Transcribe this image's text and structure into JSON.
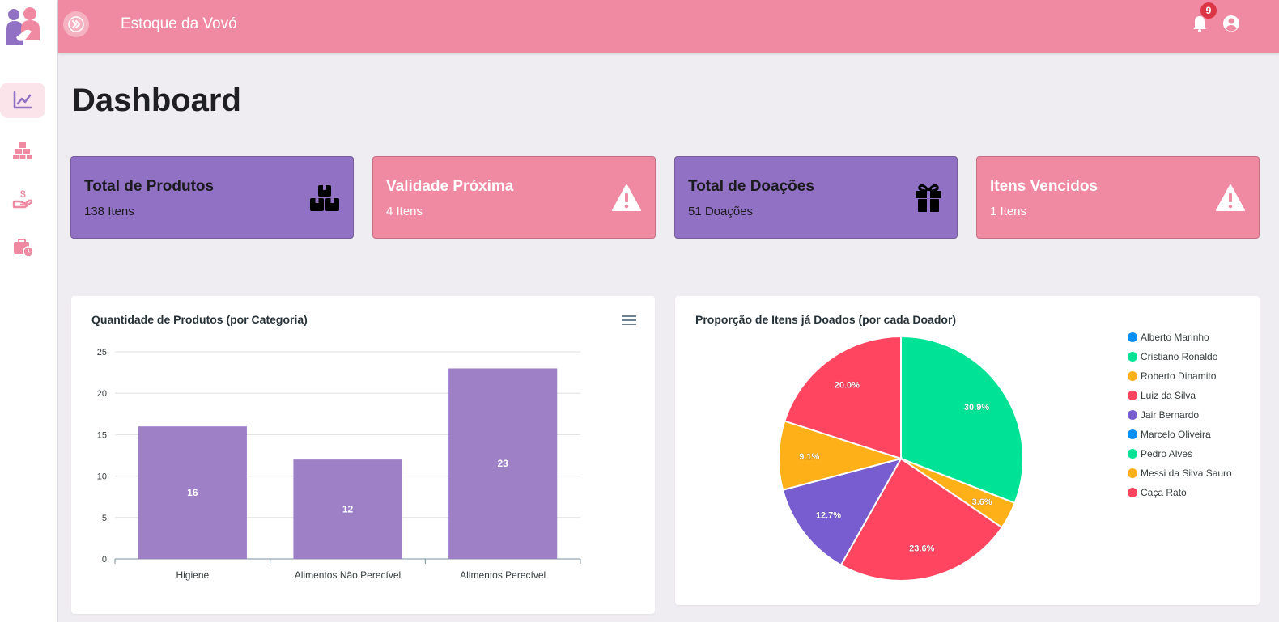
{
  "app": {
    "title": "Estoque da Vovó",
    "notification_count": "9"
  },
  "sidebar": {
    "items": [
      {
        "name": "dashboard",
        "icon": "chart-line-icon",
        "active": true
      },
      {
        "name": "products",
        "icon": "boxes-stacked-icon",
        "active": false
      },
      {
        "name": "donations",
        "icon": "hand-holding-dollar-icon",
        "active": false
      },
      {
        "name": "expiry",
        "icon": "briefcase-clock-icon",
        "active": false
      }
    ]
  },
  "page": {
    "title": "Dashboard"
  },
  "cards": [
    {
      "title": "Total de Produtos",
      "value": "138 Itens",
      "icon": "boxes-icon",
      "color": "#9171c3"
    },
    {
      "title": "Validade Próxima",
      "value": "4 Itens",
      "icon": "warning-icon",
      "color": "#f08aa2"
    },
    {
      "title": "Total de Doações",
      "value": "51 Doações",
      "icon": "gift-icon",
      "color": "#9171c3"
    },
    {
      "title": "Itens Vencidos",
      "value": "1 Itens",
      "icon": "warning-icon",
      "color": "#f08aa2"
    }
  ],
  "colors": {
    "accent": "#f08aa2",
    "purple": "#9171c3",
    "bar": "#9e80c7"
  },
  "chart_data": [
    {
      "type": "bar",
      "title": "Quantidade de Produtos (por Categoria)",
      "categories": [
        "Higiene",
        "Alimentos Não Perecível",
        "Alimentos Perecível"
      ],
      "values": [
        16,
        12,
        23
      ],
      "ylim": [
        0,
        25
      ],
      "yticks": [
        0,
        5,
        10,
        15,
        20,
        25
      ],
      "grid": true
    },
    {
      "type": "pie",
      "title": "Proporção de Itens já Doados (por cada Doador)",
      "legend_position": "right",
      "legend": [
        {
          "label": "Alberto Marinho",
          "color": "#008ffb"
        },
        {
          "label": "Cristiano Ronaldo",
          "color": "#00e396"
        },
        {
          "label": "Roberto Dinamito",
          "color": "#feb019"
        },
        {
          "label": "Luiz da Silva",
          "color": "#ff4560"
        },
        {
          "label": "Jair Bernardo",
          "color": "#775dd0"
        },
        {
          "label": "Marcelo Oliveira",
          "color": "#008ffb"
        },
        {
          "label": "Pedro Alves",
          "color": "#00e396"
        },
        {
          "label": "Messi da Silva Sauro",
          "color": "#feb019"
        },
        {
          "label": "Caça Rato",
          "color": "#ff4560"
        }
      ],
      "slices": [
        {
          "value": 30.9,
          "label": "30.9%",
          "color": "#00e396"
        },
        {
          "value": 3.6,
          "label": "3.6%",
          "color": "#feb019"
        },
        {
          "value": 23.6,
          "label": "23.6%",
          "color": "#ff4560"
        },
        {
          "value": 12.7,
          "label": "12.7%",
          "color": "#775dd0"
        },
        {
          "value": 9.1,
          "label": "9.1%",
          "color": "#feb019"
        },
        {
          "value": 20.0,
          "label": "20.0%",
          "color": "#ff4560"
        }
      ]
    }
  ]
}
